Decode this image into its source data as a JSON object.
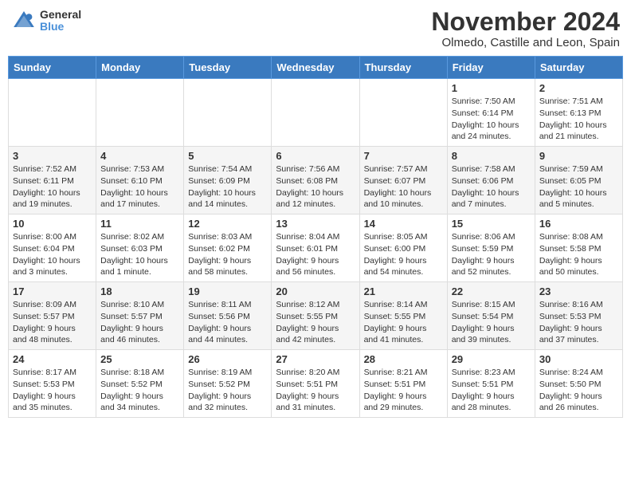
{
  "logo": {
    "general": "General",
    "blue": "Blue"
  },
  "title": "November 2024",
  "location": "Olmedo, Castille and Leon, Spain",
  "days_of_week": [
    "Sunday",
    "Monday",
    "Tuesday",
    "Wednesday",
    "Thursday",
    "Friday",
    "Saturday"
  ],
  "weeks": [
    [
      {
        "day": "",
        "info": ""
      },
      {
        "day": "",
        "info": ""
      },
      {
        "day": "",
        "info": ""
      },
      {
        "day": "",
        "info": ""
      },
      {
        "day": "",
        "info": ""
      },
      {
        "day": "1",
        "info": "Sunrise: 7:50 AM\nSunset: 6:14 PM\nDaylight: 10 hours\nand 24 minutes."
      },
      {
        "day": "2",
        "info": "Sunrise: 7:51 AM\nSunset: 6:13 PM\nDaylight: 10 hours\nand 21 minutes."
      }
    ],
    [
      {
        "day": "3",
        "info": "Sunrise: 7:52 AM\nSunset: 6:11 PM\nDaylight: 10 hours\nand 19 minutes."
      },
      {
        "day": "4",
        "info": "Sunrise: 7:53 AM\nSunset: 6:10 PM\nDaylight: 10 hours\nand 17 minutes."
      },
      {
        "day": "5",
        "info": "Sunrise: 7:54 AM\nSunset: 6:09 PM\nDaylight: 10 hours\nand 14 minutes."
      },
      {
        "day": "6",
        "info": "Sunrise: 7:56 AM\nSunset: 6:08 PM\nDaylight: 10 hours\nand 12 minutes."
      },
      {
        "day": "7",
        "info": "Sunrise: 7:57 AM\nSunset: 6:07 PM\nDaylight: 10 hours\nand 10 minutes."
      },
      {
        "day": "8",
        "info": "Sunrise: 7:58 AM\nSunset: 6:06 PM\nDaylight: 10 hours\nand 7 minutes."
      },
      {
        "day": "9",
        "info": "Sunrise: 7:59 AM\nSunset: 6:05 PM\nDaylight: 10 hours\nand 5 minutes."
      }
    ],
    [
      {
        "day": "10",
        "info": "Sunrise: 8:00 AM\nSunset: 6:04 PM\nDaylight: 10 hours\nand 3 minutes."
      },
      {
        "day": "11",
        "info": "Sunrise: 8:02 AM\nSunset: 6:03 PM\nDaylight: 10 hours\nand 1 minute."
      },
      {
        "day": "12",
        "info": "Sunrise: 8:03 AM\nSunset: 6:02 PM\nDaylight: 9 hours\nand 58 minutes."
      },
      {
        "day": "13",
        "info": "Sunrise: 8:04 AM\nSunset: 6:01 PM\nDaylight: 9 hours\nand 56 minutes."
      },
      {
        "day": "14",
        "info": "Sunrise: 8:05 AM\nSunset: 6:00 PM\nDaylight: 9 hours\nand 54 minutes."
      },
      {
        "day": "15",
        "info": "Sunrise: 8:06 AM\nSunset: 5:59 PM\nDaylight: 9 hours\nand 52 minutes."
      },
      {
        "day": "16",
        "info": "Sunrise: 8:08 AM\nSunset: 5:58 PM\nDaylight: 9 hours\nand 50 minutes."
      }
    ],
    [
      {
        "day": "17",
        "info": "Sunrise: 8:09 AM\nSunset: 5:57 PM\nDaylight: 9 hours\nand 48 minutes."
      },
      {
        "day": "18",
        "info": "Sunrise: 8:10 AM\nSunset: 5:57 PM\nDaylight: 9 hours\nand 46 minutes."
      },
      {
        "day": "19",
        "info": "Sunrise: 8:11 AM\nSunset: 5:56 PM\nDaylight: 9 hours\nand 44 minutes."
      },
      {
        "day": "20",
        "info": "Sunrise: 8:12 AM\nSunset: 5:55 PM\nDaylight: 9 hours\nand 42 minutes."
      },
      {
        "day": "21",
        "info": "Sunrise: 8:14 AM\nSunset: 5:55 PM\nDaylight: 9 hours\nand 41 minutes."
      },
      {
        "day": "22",
        "info": "Sunrise: 8:15 AM\nSunset: 5:54 PM\nDaylight: 9 hours\nand 39 minutes."
      },
      {
        "day": "23",
        "info": "Sunrise: 8:16 AM\nSunset: 5:53 PM\nDaylight: 9 hours\nand 37 minutes."
      }
    ],
    [
      {
        "day": "24",
        "info": "Sunrise: 8:17 AM\nSunset: 5:53 PM\nDaylight: 9 hours\nand 35 minutes."
      },
      {
        "day": "25",
        "info": "Sunrise: 8:18 AM\nSunset: 5:52 PM\nDaylight: 9 hours\nand 34 minutes."
      },
      {
        "day": "26",
        "info": "Sunrise: 8:19 AM\nSunset: 5:52 PM\nDaylight: 9 hours\nand 32 minutes."
      },
      {
        "day": "27",
        "info": "Sunrise: 8:20 AM\nSunset: 5:51 PM\nDaylight: 9 hours\nand 31 minutes."
      },
      {
        "day": "28",
        "info": "Sunrise: 8:21 AM\nSunset: 5:51 PM\nDaylight: 9 hours\nand 29 minutes."
      },
      {
        "day": "29",
        "info": "Sunrise: 8:23 AM\nSunset: 5:51 PM\nDaylight: 9 hours\nand 28 minutes."
      },
      {
        "day": "30",
        "info": "Sunrise: 8:24 AM\nSunset: 5:50 PM\nDaylight: 9 hours\nand 26 minutes."
      }
    ]
  ]
}
